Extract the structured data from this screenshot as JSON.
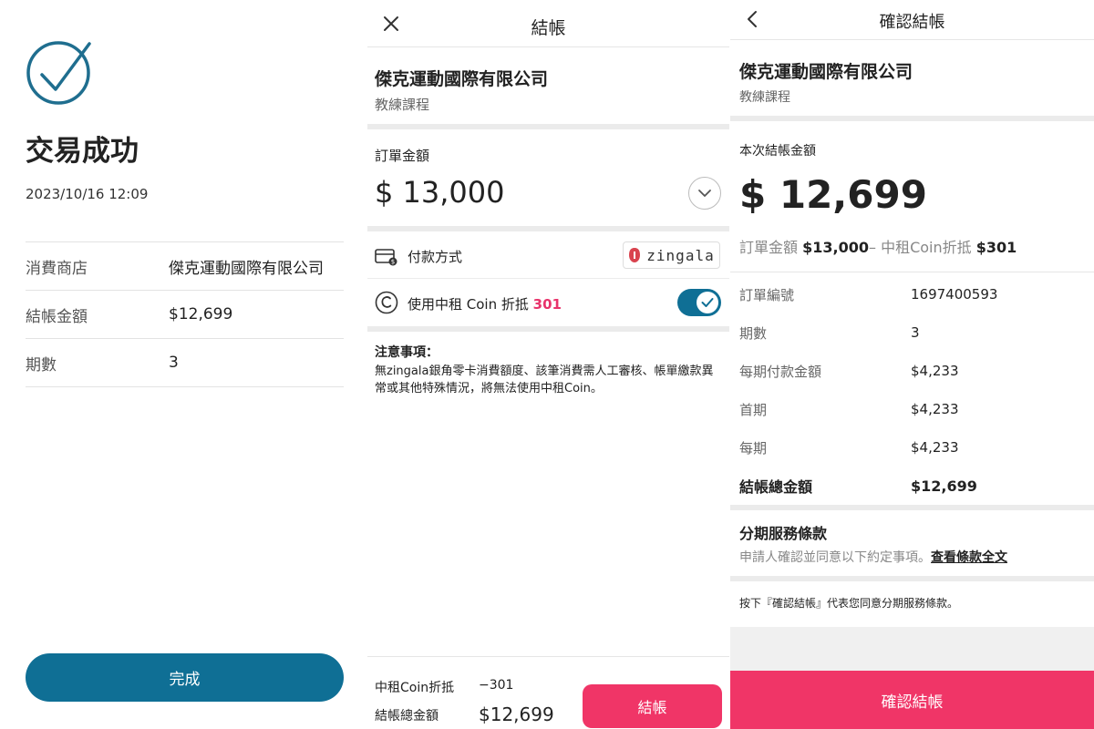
{
  "success_screen": {
    "title": "交易成功",
    "datetime": "2023/10/16 12:09",
    "rows": [
      {
        "label": "消費商店",
        "value": "傑克運動國際有限公司"
      },
      {
        "label": "結帳金額",
        "value": "$12,699"
      },
      {
        "label": "期數",
        "value": "3"
      }
    ],
    "done_label": "完成"
  },
  "checkout_screen": {
    "title": "結帳",
    "merchant": "傑克運動國際有限公司",
    "item": "教練課程",
    "order_amount_label": "訂單金額",
    "order_amount": "$ 13,000",
    "payment_method_label": "付款方式",
    "payment_provider": "zingala",
    "coin_label": "使用中租 Coin 折抵",
    "coin_points": "301",
    "coin_toggle_on": true,
    "notice_title": "注意事項：",
    "notice_text": "無zingala銀角零卡消費額度、該筆消費需人工審核、帳單繳款異常或其他特殊情況，將無法使用中租Coin。",
    "footer": {
      "coin_discount_label": "中租Coin折抵",
      "coin_discount_value": "−301",
      "total_label": "結帳總金額",
      "total_value": "$12,699",
      "checkout_label": "結帳"
    }
  },
  "confirm_screen": {
    "title": "確認結帳",
    "merchant": "傑克運動國際有限公司",
    "item": "教練課程",
    "amount_label": "本次結帳金額",
    "amount": "$ 12,699",
    "breakdown": {
      "order_label": "訂單金額",
      "order_value": "$13,000",
      "minus": "–",
      "coin_label": "中租Coin折抵",
      "coin_value": "$301"
    },
    "details": [
      {
        "label": "訂單編號",
        "value": "1697400593"
      },
      {
        "label": "期數",
        "value": "3"
      },
      {
        "label": "每期付款金額",
        "value": "$4,233"
      },
      {
        "label": "首期",
        "value": "$4,233"
      },
      {
        "label": "每期",
        "value": "$4,233"
      }
    ],
    "total_label": "結帳總金額",
    "total_value": "$12,699",
    "terms_title": "分期服務條款",
    "terms_text": "申請人確認並同意以下約定事項。",
    "terms_link": "查看條款全文",
    "agree_text": "按下『確認結帳』代表您同意分期服務條款。",
    "confirm_label": "確認結帳"
  },
  "colors": {
    "primary_blue": "#0f6f95",
    "accent_pink": "#f03567",
    "coin_pink": "#e8336b",
    "zingala_red": "#d9434e"
  }
}
